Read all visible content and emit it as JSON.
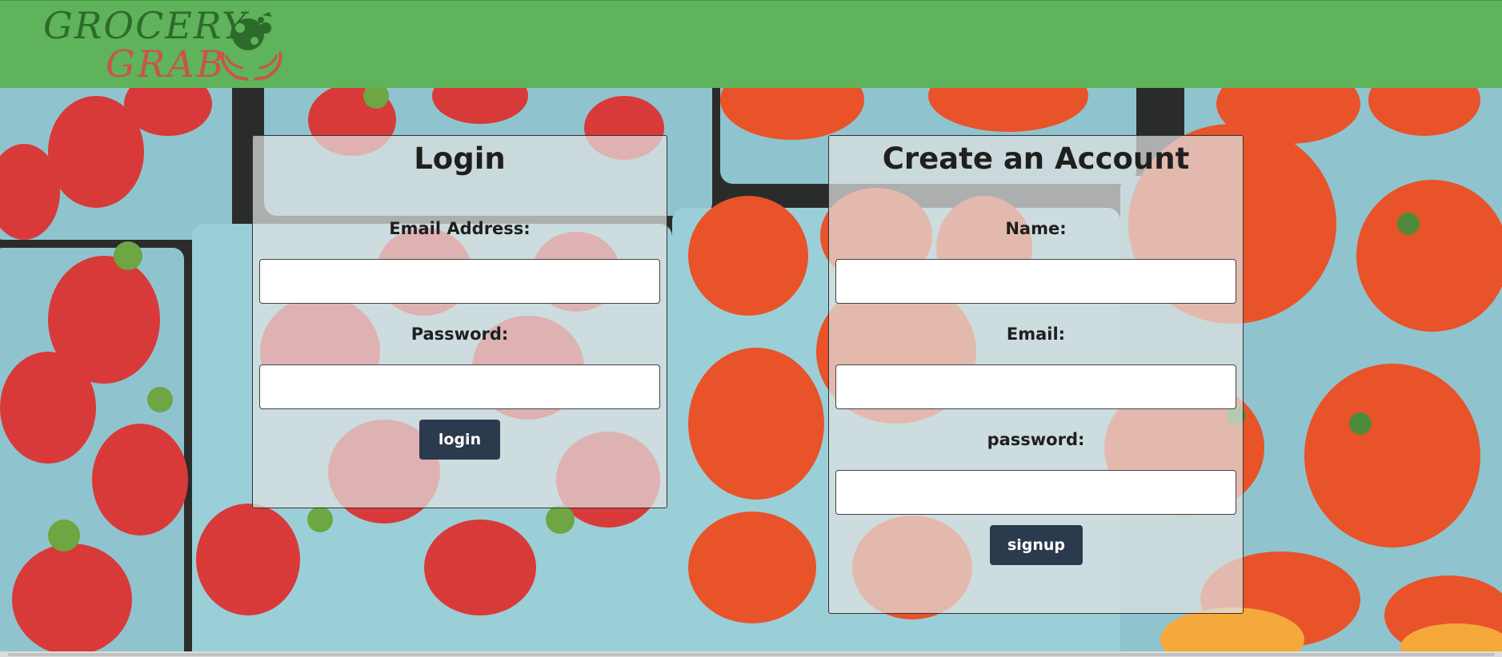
{
  "header": {
    "logo_line1": "GROCERY",
    "logo_line2": "GRAB",
    "colors": {
      "bar": "#5fb35a",
      "logo_green": "#2d6b2b",
      "logo_red": "#c9544c"
    },
    "logo_icon": "produce-in-hands-icon"
  },
  "login": {
    "title": "Login",
    "email_label": "Email Address:",
    "email_value": "",
    "password_label": "Password:",
    "password_value": "",
    "button_label": "login"
  },
  "signup": {
    "title": "Create an Account",
    "name_label": "Name:",
    "name_value": "",
    "email_label": "Email:",
    "email_value": "",
    "password_label": "password:",
    "password_value": "",
    "button_label": "signup"
  },
  "theme": {
    "button_bg": "#2b3a4d",
    "panel_bg": "rgba(225,225,225,0.72)"
  }
}
